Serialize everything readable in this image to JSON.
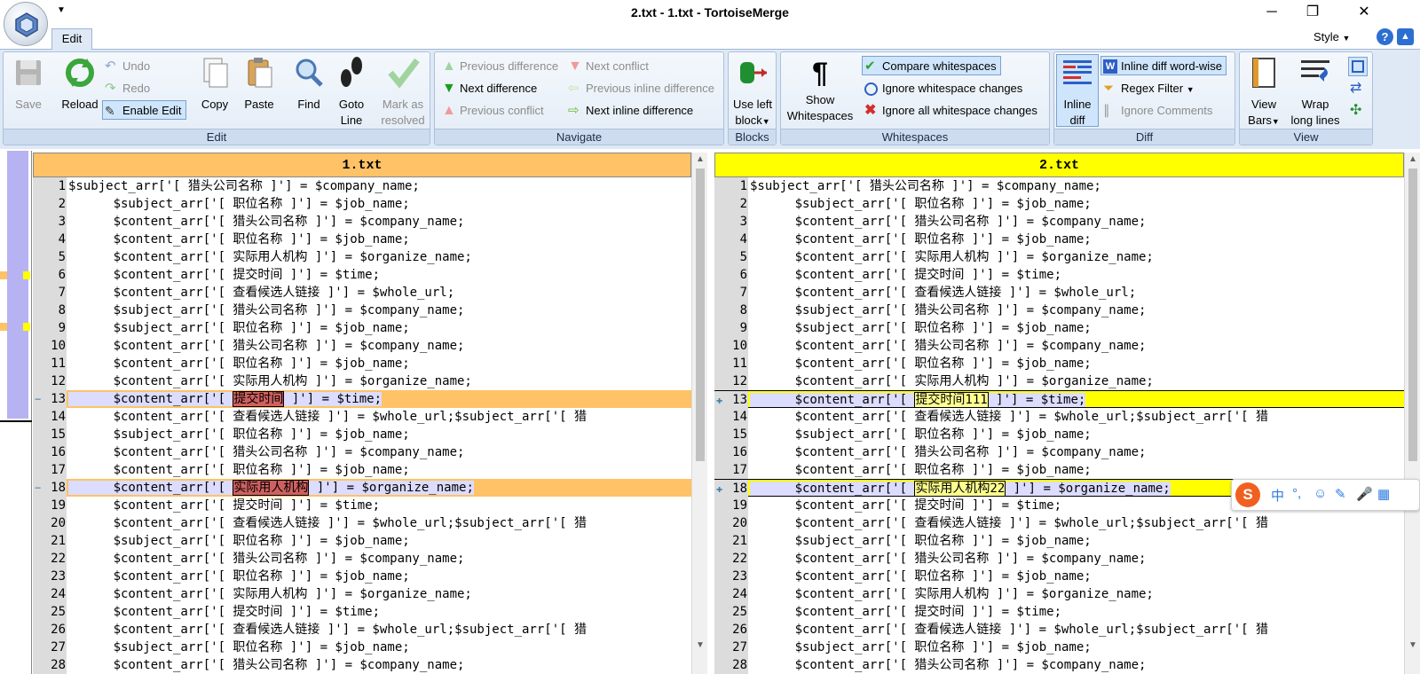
{
  "window": {
    "title": "2.txt - 1.txt - TortoiseMerge"
  },
  "tabs": {
    "edit": "Edit"
  },
  "style_menu": "Style",
  "ribbon": {
    "edit_group": {
      "label": "Edit",
      "save": "Save",
      "reload": "Reload",
      "undo": "Undo",
      "redo": "Redo",
      "enable_edit": "Enable Edit",
      "copy": "Copy",
      "paste": "Paste",
      "find": "Find",
      "goto_line": [
        "Goto",
        "Line"
      ],
      "mark_resolved": [
        "Mark as",
        "resolved"
      ]
    },
    "navigate_group": {
      "label": "Navigate",
      "previous_difference": "Previous difference",
      "next_difference": "Next difference",
      "previous_conflict": "Previous conflict",
      "next_conflict": "Next conflict",
      "previous_inline_difference": "Previous inline difference",
      "next_inline_difference": "Next inline difference"
    },
    "blocks_group": {
      "label": "Blocks",
      "use_left_block": [
        "Use left",
        "block"
      ]
    },
    "whitespaces_group": {
      "label": "Whitespaces",
      "show_whitespaces": [
        "Show",
        "Whitespaces"
      ],
      "compare_whitespaces": "Compare whitespaces",
      "ignore_whitespace_changes": "Ignore whitespace changes",
      "ignore_all_whitespace_changes": "Ignore all whitespace changes"
    },
    "diff_group": {
      "label": "Diff",
      "inline_diff": [
        "Inline",
        "diff"
      ],
      "inline_diff_word_wise": "Inline diff word-wise",
      "regex_filter": "Regex Filter",
      "ignore_comments": "Ignore Comments"
    },
    "view_group": {
      "label": "View",
      "view_bars": [
        "View",
        "Bars"
      ],
      "wrap_long_lines": [
        "Wrap",
        "long lines"
      ]
    }
  },
  "colors": {
    "left_header": "#ffc266",
    "right_header": "#ffff00",
    "left_changed_line": "#dcdcff",
    "left_changed_tail": "#ffc266",
    "left_changed_word": "#d06060",
    "right_changed_line": "#dcdcff",
    "right_changed_tail": "#ffff00",
    "right_changed_word": "#ffff90"
  },
  "left_pane": {
    "title": "1.txt",
    "lines": [
      {
        "n": "1",
        "t": "$subject_arr['[ 猎头公司名称 ]'] = $company_name;"
      },
      {
        "n": "2",
        "t": "      $subject_arr['[ 职位名称 ]'] = $job_name;"
      },
      {
        "n": "3",
        "t": "      $content_arr['[ 猎头公司名称 ]'] = $company_name;"
      },
      {
        "n": "4",
        "t": "      $content_arr['[ 职位名称 ]'] = $job_name;"
      },
      {
        "n": "5",
        "t": "      $content_arr['[ 实际用人机构 ]'] = $organize_name;"
      },
      {
        "n": "6",
        "t": "      $content_arr['[ 提交时间 ]'] = $time;"
      },
      {
        "n": "7",
        "t": "      $content_arr['[ 查看候选人链接 ]'] = $whole_url;"
      },
      {
        "n": "8",
        "t": "      $subject_arr['[ 猎头公司名称 ]'] = $company_name;"
      },
      {
        "n": "9",
        "t": "      $subject_arr['[ 职位名称 ]'] = $job_name;"
      },
      {
        "n": "10",
        "t": "      $content_arr['[ 猎头公司名称 ]'] = $company_name;"
      },
      {
        "n": "11",
        "t": "      $content_arr['[ 职位名称 ]'] = $job_name;"
      },
      {
        "n": "12",
        "t": "      $content_arr['[ 实际用人机构 ]'] = $organize_name;"
      },
      {
        "n": "13",
        "changed": true,
        "pre": "      $content_arr['[ ",
        "word": "提交时间",
        "post": " ]'] = $time;"
      },
      {
        "n": "14",
        "t": "      $content_arr['[ 查看候选人链接 ]'] = $whole_url;$subject_arr['[ 猎"
      },
      {
        "n": "15",
        "t": "      $subject_arr['[ 职位名称 ]'] = $job_name;"
      },
      {
        "n": "16",
        "t": "      $content_arr['[ 猎头公司名称 ]'] = $company_name;"
      },
      {
        "n": "17",
        "t": "      $content_arr['[ 职位名称 ]'] = $job_name;"
      },
      {
        "n": "18",
        "changed": true,
        "pre": "      $content_arr['[ ",
        "word": "实际用人机构",
        "post": " ]'] = $organize_name;"
      },
      {
        "n": "19",
        "t": "      $content_arr['[ 提交时间 ]'] = $time;"
      },
      {
        "n": "20",
        "t": "      $content_arr['[ 查看候选人链接 ]'] = $whole_url;$subject_arr['[ 猎"
      },
      {
        "n": "21",
        "t": "      $subject_arr['[ 职位名称 ]'] = $job_name;"
      },
      {
        "n": "22",
        "t": "      $content_arr['[ 猎头公司名称 ]'] = $company_name;"
      },
      {
        "n": "23",
        "t": "      $content_arr['[ 职位名称 ]'] = $job_name;"
      },
      {
        "n": "24",
        "t": "      $content_arr['[ 实际用人机构 ]'] = $organize_name;"
      },
      {
        "n": "25",
        "t": "      $content_arr['[ 提交时间 ]'] = $time;"
      },
      {
        "n": "26",
        "t": "      $content_arr['[ 查看候选人链接 ]'] = $whole_url;$subject_arr['[ 猎"
      },
      {
        "n": "27",
        "t": "      $subject_arr['[ 职位名称 ]'] = $job_name;"
      },
      {
        "n": "28",
        "t": "      $content_arr['[ 猎头公司名称 ]'] = $company_name;"
      }
    ]
  },
  "right_pane": {
    "title": "2.txt",
    "lines": [
      {
        "n": "1",
        "t": "$subject_arr['[ 猎头公司名称 ]'] = $company_name;"
      },
      {
        "n": "2",
        "t": "      $subject_arr['[ 职位名称 ]'] = $job_name;"
      },
      {
        "n": "3",
        "t": "      $content_arr['[ 猎头公司名称 ]'] = $company_name;"
      },
      {
        "n": "4",
        "t": "      $content_arr['[ 职位名称 ]'] = $job_name;"
      },
      {
        "n": "5",
        "t": "      $content_arr['[ 实际用人机构 ]'] = $organize_name;"
      },
      {
        "n": "6",
        "t": "      $content_arr['[ 提交时间 ]'] = $time;"
      },
      {
        "n": "7",
        "t": "      $content_arr['[ 查看候选人链接 ]'] = $whole_url;"
      },
      {
        "n": "8",
        "t": "      $subject_arr['[ 猎头公司名称 ]'] = $company_name;"
      },
      {
        "n": "9",
        "t": "      $subject_arr['[ 职位名称 ]'] = $job_name;"
      },
      {
        "n": "10",
        "t": "      $content_arr['[ 猎头公司名称 ]'] = $company_name;"
      },
      {
        "n": "11",
        "t": "      $content_arr['[ 职位名称 ]'] = $job_name;"
      },
      {
        "n": "12",
        "t": "      $content_arr['[ 实际用人机构 ]'] = $organize_name;"
      },
      {
        "n": "13",
        "changed": true,
        "pre": "      $content_arr['[ ",
        "word": "提交时间111",
        "post": " ]'] = $time;"
      },
      {
        "n": "14",
        "t": "      $content_arr['[ 查看候选人链接 ]'] = $whole_url;$subject_arr['[ 猎"
      },
      {
        "n": "15",
        "t": "      $subject_arr['[ 职位名称 ]'] = $job_name;"
      },
      {
        "n": "16",
        "t": "      $content_arr['[ 猎头公司名称 ]'] = $company_name;"
      },
      {
        "n": "17",
        "t": "      $content_arr['[ 职位名称 ]'] = $job_name;"
      },
      {
        "n": "18",
        "changed": true,
        "pre": "      $content_arr['[ ",
        "word": "实际用人机构22",
        "post": " ]'] = $organize_name;"
      },
      {
        "n": "19",
        "t": "      $content_arr['[ 提交时间 ]'] = $time;"
      },
      {
        "n": "20",
        "t": "      $content_arr['[ 查看候选人链接 ]'] = $whole_url;$subject_arr['[ 猎"
      },
      {
        "n": "21",
        "t": "      $subject_arr['[ 职位名称 ]'] = $job_name;"
      },
      {
        "n": "22",
        "t": "      $content_arr['[ 猎头公司名称 ]'] = $company_name;"
      },
      {
        "n": "23",
        "t": "      $content_arr['[ 职位名称 ]'] = $job_name;"
      },
      {
        "n": "24",
        "t": "      $content_arr['[ 实际用人机构 ]'] = $organize_name;"
      },
      {
        "n": "25",
        "t": "      $content_arr['[ 提交时间 ]'] = $time;"
      },
      {
        "n": "26",
        "t": "      $content_arr['[ 查看候选人链接 ]'] = $whole_url;$subject_arr['[ 猎"
      },
      {
        "n": "27",
        "t": "      $subject_arr['[ 职位名称 ]'] = $job_name;"
      },
      {
        "n": "28",
        "t": "      $content_arr['[ 猎头公司名称 ]'] = $company_name;"
      }
    ]
  },
  "ime_toolbar": {
    "mode": "中"
  }
}
